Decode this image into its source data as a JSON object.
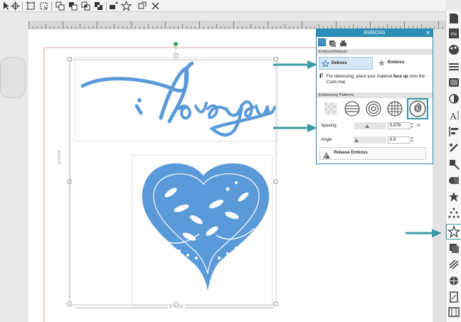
{
  "toolbar": {
    "buttons": [
      "crosshair-tool",
      "align-tool",
      "group-tool",
      "group-select",
      "weld",
      "subtract",
      "intersect",
      "send-back",
      "bring-front",
      "star-fill",
      "replicate",
      "close"
    ]
  },
  "ruler": {
    "label": "ruler"
  },
  "canvas": {
    "text_art": "i love you",
    "dim_height": "4.579 in",
    "dim_width": "3.750 in",
    "accent": "#5b9ad9"
  },
  "panel": {
    "title": "EMBOSS",
    "section_emboss": "Emboss/Deboss",
    "deboss_label": "Deboss",
    "emboss_label": "Emboss",
    "info_letter": "F",
    "info_text_1": "For debossing, place your material",
    "info_bold": "face up",
    "info_text_2": "onto the Curio mat.",
    "section_patterns": "Embossing Patterns",
    "spacing_label": "Spacing",
    "spacing_value": "0.079",
    "spacing_unit": "in",
    "angle_label": "Angle",
    "angle_value": "0.0",
    "release_label": "Release Emboss"
  },
  "colors": {
    "panel_accent": "#2b8fb6",
    "arrow": "#3b9aa7",
    "art": "#5b9ad9"
  }
}
